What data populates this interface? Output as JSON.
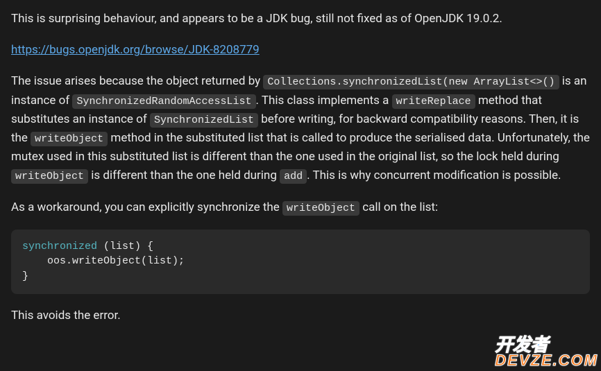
{
  "para1": "This is surprising behaviour, and appears to be a JDK bug, still not fixed as of OpenJDK 19.0.2.",
  "bug_link": {
    "text": "https://bugs.openjdk.org/browse/JDK-8208779",
    "href": "https://bugs.openjdk.org/browse/JDK-8208779"
  },
  "para2": {
    "seg1": "The issue arises because the object returned by ",
    "code1": "Collections.synchronizedList(new ArrayList<>()",
    "seg2": " is an instance of ",
    "code2": "SynchronizedRandomAccessList",
    "seg3": ". This class implements a ",
    "code3": "writeReplace",
    "seg4": " method that substitutes an instance of ",
    "code4": "SynchronizedList",
    "seg5": " before writing, for backward compatibility reasons. Then, it is the ",
    "code5": "writeObject",
    "seg6": " method in the substituted list that is called to produce the serialised data. Unfortunately, the mutex used in this substituted list is different than the one used in the original list, so the lock held during ",
    "code6": "writeObject",
    "seg7": " is different than the one held during ",
    "code7": "add",
    "seg8": ". This is why concurrent modification is possible."
  },
  "para3": {
    "seg1": "As a workaround, you can explicitly synchronize the ",
    "code1": "writeObject",
    "seg2": " call on the list:"
  },
  "codeblock": {
    "kw": "synchronized",
    "rest": " (list) {\n    oos.writeObject(list);\n}"
  },
  "para4": "This avoids the error.",
  "watermark": {
    "line1": "开发者",
    "line2": "DEVZE.COM"
  }
}
